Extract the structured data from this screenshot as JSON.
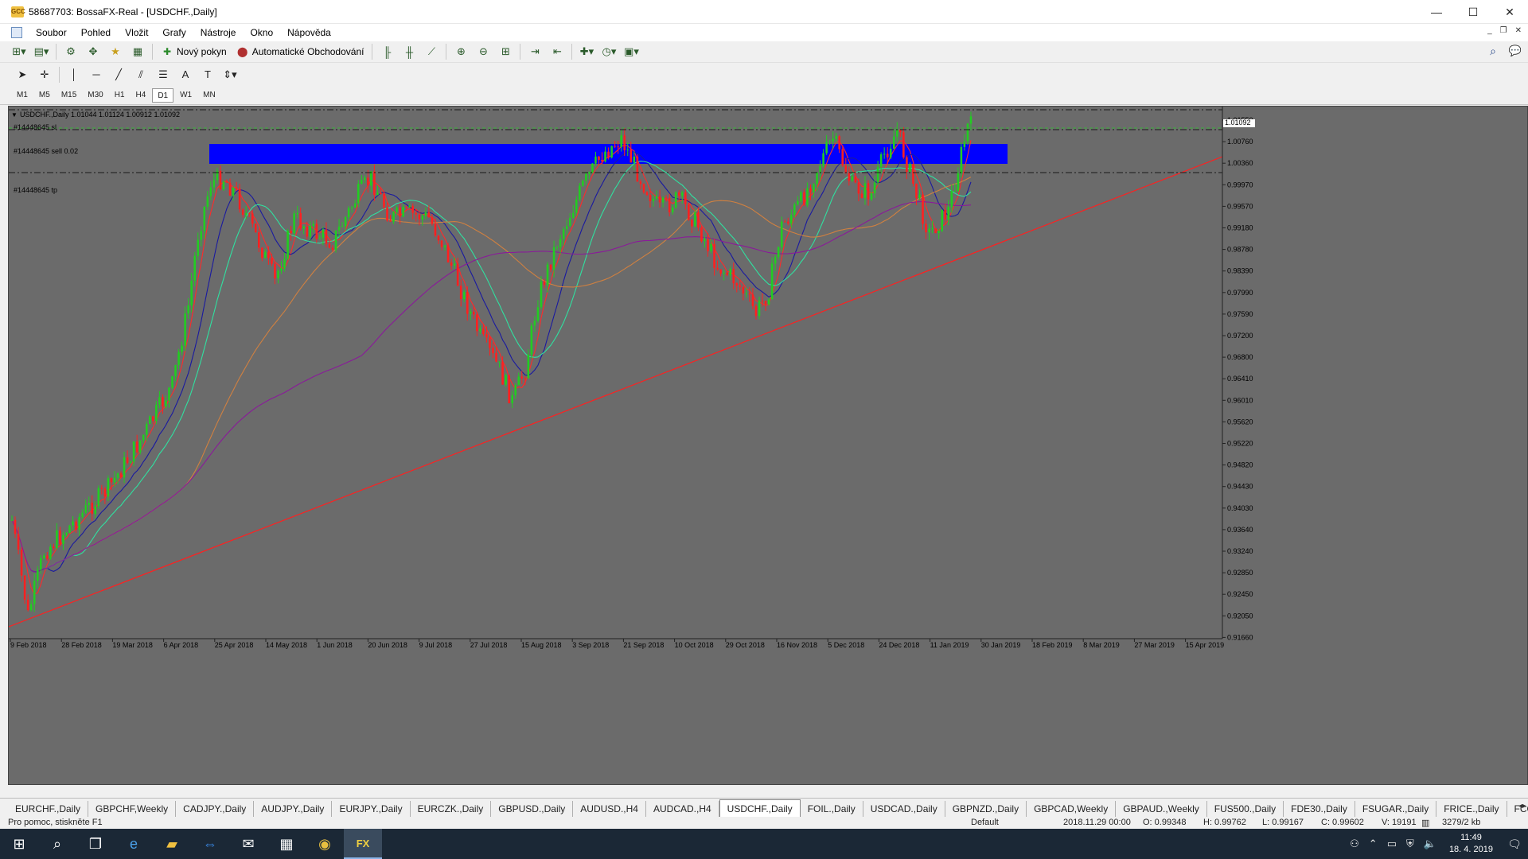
{
  "window": {
    "title": "58687703: BossaFX-Real - [USDCHF.,Daily]",
    "app_icon": "GCC",
    "min": "—",
    "max": "☐",
    "close": "✕"
  },
  "menu": [
    "Soubor",
    "Pohled",
    "Vložit",
    "Grafy",
    "Nástroje",
    "Okno",
    "Nápověda"
  ],
  "toolbar": {
    "new_order": "Nový pokyn",
    "auto_trading": "Automatické Obchodování"
  },
  "timeframes": [
    "M1",
    "M5",
    "M15",
    "M30",
    "H1",
    "H4",
    "D1",
    "W1",
    "MN"
  ],
  "active_timeframe": "D1",
  "chart": {
    "header": "USDCHF.,Daily  1.01044 1.01124 1.00912 1.01092",
    "lines": {
      "sl": "#14448645 sl",
      "sell": "#14448645 sell 0.02",
      "tp": "#14448645 tp"
    },
    "current_price": "1.01092",
    "price_labels": [
      "1.01550",
      "1.00760",
      "1.00360",
      "0.99970",
      "0.99570",
      "0.99180",
      "0.98780",
      "0.98390",
      "0.97990",
      "0.97590",
      "0.97200",
      "0.96800",
      "0.96410",
      "0.96010",
      "0.95620",
      "0.95220",
      "0.94820",
      "0.94430",
      "0.94030",
      "0.93640",
      "0.93240",
      "0.92850",
      "0.92450",
      "0.92050",
      "0.91660"
    ],
    "date_labels": [
      "9 Feb 2018",
      "28 Feb 2018",
      "19 Mar 2018",
      "6 Apr 2018",
      "25 Apr 2018",
      "14 May 2018",
      "1 Jun 2018",
      "20 Jun 2018",
      "9 Jul 2018",
      "27 Jul 2018",
      "15 Aug 2018",
      "3 Sep 2018",
      "21 Sep 2018",
      "10 Oct 2018",
      "29 Oct 2018",
      "16 Nov 2018",
      "5 Dec 2018",
      "24 Dec 2018",
      "11 Jan 2019",
      "30 Jan 2019",
      "18 Feb 2019",
      "8 Mar 2019",
      "27 Mar 2019",
      "15 Apr 2019"
    ],
    "colors": {
      "background": "#6b6b6b",
      "bull": "#22cc22",
      "bear": "#ff2020",
      "zone": "#0000ff",
      "trendline": "#ff2020",
      "ma_fast": "#ff2a2a",
      "ma_blue": "#1a1aa0",
      "ma_cyan": "#30e0a0",
      "ma_orange": "#d08040",
      "ma_purple": "#8a1a9a"
    }
  },
  "tabs": [
    "EURCHF.,Daily",
    "GBPCHF,Weekly",
    "CADJPY.,Daily",
    "AUDJPY.,Daily",
    "EURJPY.,Daily",
    "EURCZK.,Daily",
    "GBPUSD.,Daily",
    "AUDUSD.,H4",
    "AUDCAD.,H4",
    "USDCHF.,Daily",
    "FOIL.,Daily",
    "USDCAD.,Daily",
    "GBPNZD.,Daily",
    "GBPCAD,Weekly",
    "GBPAUD.,Weekly",
    "FUS500.,Daily",
    "FDE30.,Daily",
    "FSUGAR.,Daily",
    "FRICE.,Daily",
    "FCOTT"
  ],
  "active_tab": "USDCHF.,Daily",
  "status": {
    "help": "Pro pomoc, stiskněte F1",
    "profile": "Default",
    "datetime": "2018.11.29 00:00",
    "open": "O: 0.99348",
    "high": "H: 0.99762",
    "low": "L: 0.99167",
    "close": "C: 0.99602",
    "volume": "V: 19191",
    "traffic": "3279/2 kb"
  },
  "taskbar": {
    "time": "11:49",
    "date": "18. 4. 2019",
    "notifications": "1"
  }
}
